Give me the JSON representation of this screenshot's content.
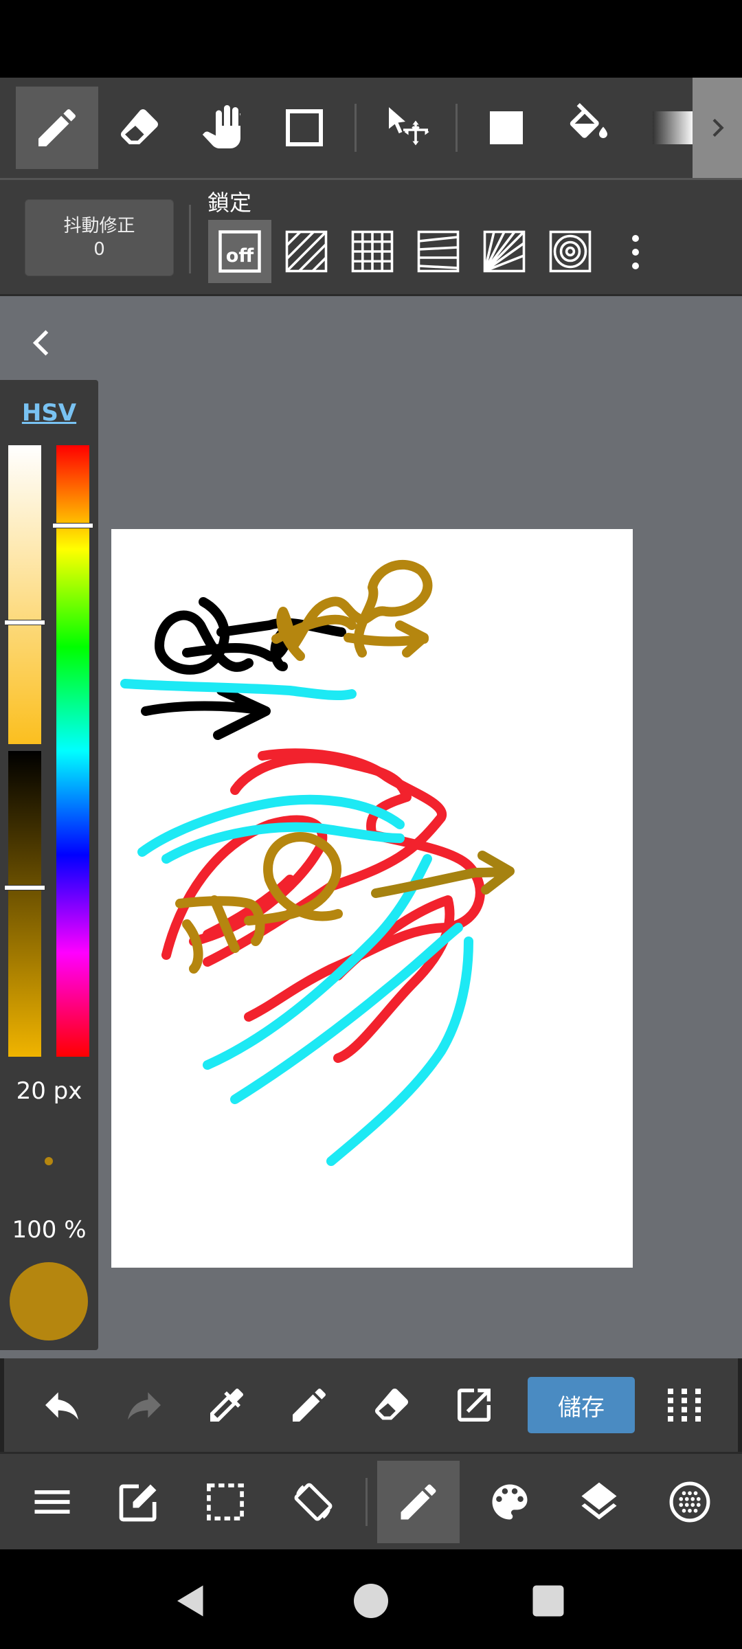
{
  "stabilizer": {
    "label": "抖動修正",
    "value": "0"
  },
  "snap": {
    "label": "鎖定",
    "off_label": "off"
  },
  "color_panel": {
    "mode": "HSV",
    "brush_size": "20 px",
    "opacity": "100 %"
  },
  "actions": {
    "save_label": "儲存"
  },
  "colors": {
    "current_color": "#b5860f",
    "save_button": "#4a8bc2",
    "mode_tab": "#79c2f2"
  },
  "icons": {
    "tools": [
      "pen-icon",
      "eraser-icon",
      "hand-icon",
      "rectangle-select-icon",
      "move-icon",
      "fill-rect-icon",
      "bucket-icon",
      "gradient-icon"
    ],
    "snaps": [
      "snap-off-icon",
      "parallel-snap-icon",
      "grid-snap-icon",
      "perspective-snap-icon",
      "radial-snap-icon",
      "circle-snap-icon"
    ],
    "actions": [
      "undo-icon",
      "redo-icon",
      "eyedropper-icon",
      "pen-icon",
      "eraser-icon",
      "share-icon",
      "grid-menu-icon"
    ],
    "bottom_menu": [
      "menu-icon",
      "edit-icon",
      "selection-icon",
      "rotate-icon",
      "brush-icon",
      "palette-icon",
      "layers-icon",
      "material-icon"
    ]
  }
}
